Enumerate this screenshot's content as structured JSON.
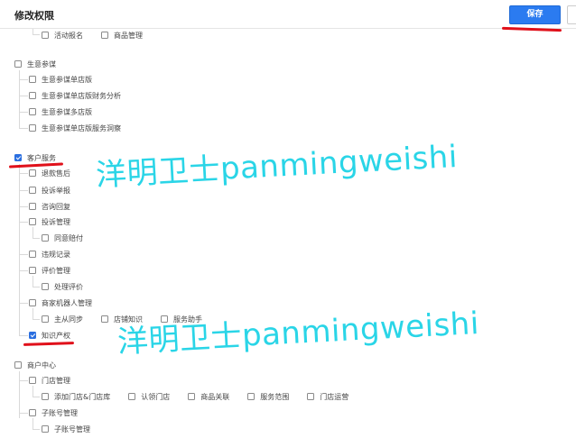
{
  "header": {
    "title": "修改权限",
    "save_label": "保存"
  },
  "tree": {
    "top_items": [
      "活动报名",
      "商品管理"
    ],
    "biz": {
      "label": "生意参谋",
      "children": [
        "生意参谋单店版",
        "生意参谋单店版财务分析",
        "生意参谋多店版",
        "生意参谋单店版服务洞察"
      ]
    },
    "service": {
      "label": "客户服务",
      "children": {
        "refund": "退款售后",
        "complaint_report": "投诉举报",
        "consult": "咨询回复",
        "complaint_mgmt": "投诉管理",
        "agree_pay": "同意赔付",
        "violation": "违规记录",
        "review_mgmt": "评价管理",
        "review_handle": "处理评价",
        "robot_mgmt": "商家机器人管理",
        "robot_sub": [
          "主从同步",
          "店铺知识",
          "服务助手"
        ],
        "ip": "知识产权"
      }
    },
    "merchant": {
      "label": "商户中心",
      "store_mgmt": "门店管理",
      "store_sub": [
        "添加门店&门店库",
        "认领门店",
        "商品关联",
        "服务范围",
        "门店运营"
      ],
      "sub_account": "子账号管理",
      "sub_account_child": "子账号管理"
    }
  },
  "watermark": {
    "text": "洋明卫士panmingweishi",
    "color": "#1fd3e6"
  },
  "colors": {
    "accent": "#2b7bf0",
    "annotation": "#e0101a"
  }
}
